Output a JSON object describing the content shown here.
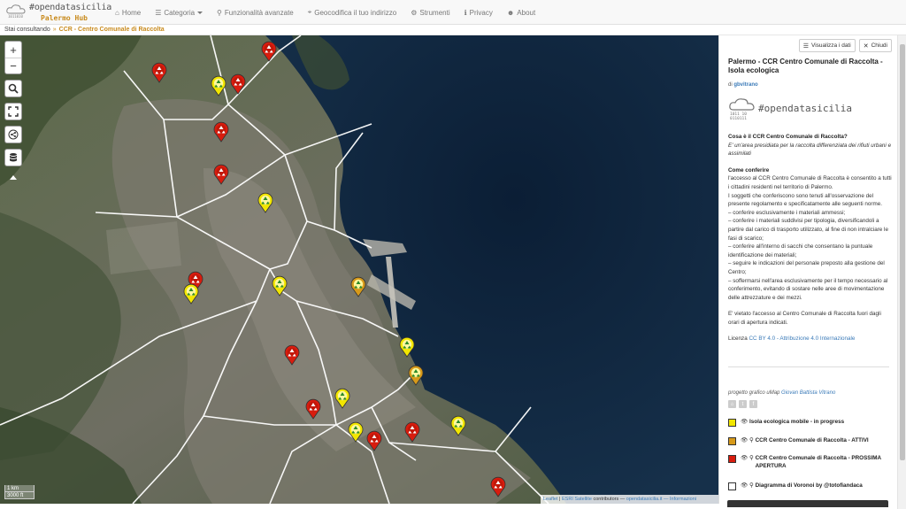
{
  "brand": {
    "title": "#opendatasicilia",
    "subtitle": "Palermo Hub"
  },
  "nav": [
    {
      "icon": "⌂",
      "label": "Home"
    },
    {
      "icon": "☰",
      "label": "Categoria"
    },
    {
      "icon": "⚲",
      "label": "Funzionalità avanzate"
    },
    {
      "icon": "⌖",
      "label": "Geocodifica il tuo indirizzo"
    },
    {
      "icon": "⚙",
      "label": "Strumenti"
    },
    {
      "icon": "ℹ",
      "label": "Privacy"
    },
    {
      "icon": "☻",
      "label": "About"
    }
  ],
  "breadcrumb": {
    "label": "Stai consultando",
    "separator": "»",
    "current": "CCR - Centro Comunale di Raccolta"
  },
  "map": {
    "zoom_in": "+",
    "zoom_out": "−",
    "scale_km": "1 km",
    "scale_ft": "3000 ft",
    "attribution_prefix": "Leaflet",
    "attribution_src": "ESRI Satellite",
    "attribution_mid": "contributors —",
    "attribution_link": "opendatasicilia.it",
    "attribution_end": "— Informazioni"
  },
  "panel": {
    "view_data": "Visualizza i dati",
    "close": "Chiudi",
    "title": "Palermo - CCR Centro Comunale di Raccolta - Isola ecologica",
    "author_prefix": "di",
    "author": "gbvitrano",
    "logo_text": "#opendatasicilia",
    "q1": "Cosa è il CCR Centro Comunale di Raccolta?",
    "a1": "E' un'area presidiata per la raccolta differenziata dei rifiuti urbani e assimilati",
    "h2": "Come conferire",
    "p2": "l'accesso al CCR Centro Comunale di Raccolta è consentito a tutti i cittadini residenti nel territorio di Palermo.",
    "p3": "I soggetti che conferiscono sono tenuti all'osservazione del presente regolamento e specificatamente alle seguenti norme.",
    "p4": "– conferire esclusivamente i materiali ammessi;",
    "p5": "– conferire i materiali suddivisi per tipologia, diversificandoli a partire dal carico di trasporto utilizzato, al fine di non intralciare le fasi di scarico;",
    "p6": "– conferire all'interno di sacchi che consentano la puntuale identificazione dei materiali;",
    "p7": "– seguire le indicazioni del personale preposto alla gestione del Centro;",
    "p8": "– soffermarsi nell'area esclusivamente per il tempo necessario al conferimento, evitando di sostare nelle aree di movimentazione delle attrezzature e dei mezzi.",
    "p9": "E' vietato l'accesso al Centro Comunale di Raccolta fuori dagli orari di apertura indicati.",
    "license_label": "Licenza",
    "license": "CC BY 4.0 - Attribuzione 4.0 Internazionale",
    "credit_prefix": "progetto grafico uMap",
    "credit_author": "Giovan Battista Vitrano",
    "social": [
      "⌂",
      "t",
      "f"
    ],
    "legend": [
      {
        "label": "Isola ecologica mobile - in progress",
        "color": "#f2e600"
      },
      {
        "label": "CCR Centro Comunale di Raccolta - ATTIVI",
        "color": "#d79a1a"
      },
      {
        "label": "CCR Centro Comunale di Raccolta - PROSSIMA APERTURA",
        "color": "#d81c0e"
      },
      {
        "label": "Diagramma di Voronoi by @totofiandaca",
        "color": "#ffffff"
      }
    ]
  },
  "colors": {
    "accent": "#c88a1c",
    "link": "#3a7ab8",
    "red": "#d81c0e",
    "yellow": "#f2e600",
    "orange": "#d79a1a"
  }
}
